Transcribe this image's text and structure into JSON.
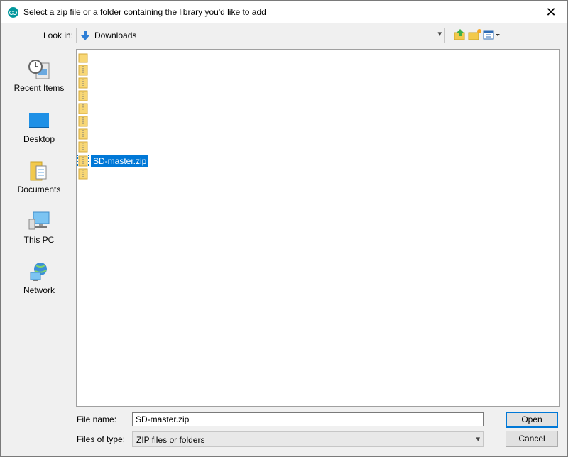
{
  "window": {
    "title": "Select a zip file or a folder containing the library you'd like to add",
    "close_glyph": "✕"
  },
  "toolbar": {
    "look_in_label": "Look in:",
    "look_in_value": "Downloads",
    "look_in_icon": "down-arrow-icon",
    "chevron": "⌄",
    "buttons": [
      "up-folder-icon",
      "new-folder-icon",
      "view-menu-icon"
    ]
  },
  "places": [
    {
      "label": "Recent Items",
      "icon": "recent-items-icon"
    },
    {
      "label": "Desktop",
      "icon": "desktop-icon"
    },
    {
      "label": "Documents",
      "icon": "documents-icon"
    },
    {
      "label": "This PC",
      "icon": "this-pc-icon"
    },
    {
      "label": "Network",
      "icon": "network-icon"
    }
  ],
  "files": [
    {
      "name": "",
      "type": "folder"
    },
    {
      "name": "",
      "type": "zip"
    },
    {
      "name": "",
      "type": "zip"
    },
    {
      "name": "",
      "type": "zip"
    },
    {
      "name": "",
      "type": "zip"
    },
    {
      "name": "",
      "type": "zip"
    },
    {
      "name": "",
      "type": "zip"
    },
    {
      "name": "",
      "type": "zip"
    },
    {
      "name": "SD-master.zip",
      "type": "zip",
      "selected": true
    },
    {
      "name": "",
      "type": "zip"
    }
  ],
  "bottom": {
    "file_name_label": "File name:",
    "file_name_value": "SD-master.zip",
    "files_of_type_label": "Files of type:",
    "files_of_type_value": "ZIP files or folders",
    "open_label": "Open",
    "cancel_label": "Cancel"
  },
  "colors": {
    "selection": "#0078d7",
    "folder": "#f8d775",
    "accent_app": "#00979c"
  }
}
